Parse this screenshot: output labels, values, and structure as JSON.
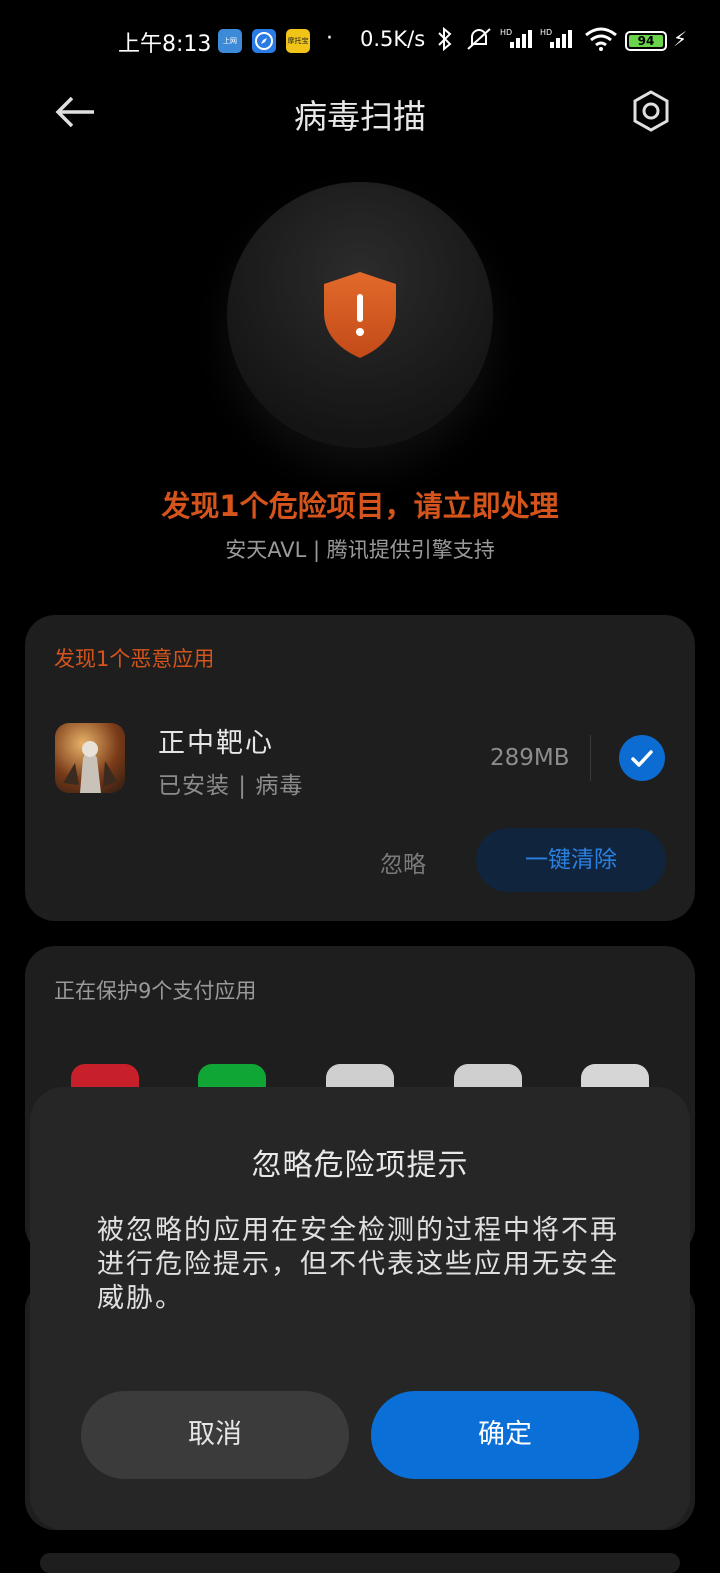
{
  "status_bar": {
    "time": "上午8:13",
    "mini_apps": [
      {
        "name": "blue-app-icon",
        "label": "上网",
        "color": "#3d8ad9"
      },
      {
        "name": "compass-app-icon",
        "label": "",
        "color": "#2a7be4"
      },
      {
        "name": "yellow-app-icon",
        "label": "摩托宝",
        "color": "#f0c419"
      }
    ],
    "dot": "·",
    "net_speed": "0.5K/s",
    "battery_level": "94",
    "battery_color": "#6ad34a"
  },
  "header": {
    "title": "病毒扫描"
  },
  "hero": {
    "title": "发现1个危险项目，请立即处理",
    "subtitle": "安天AVL | 腾讯提供引擎支持",
    "accent_color": "#d4541c"
  },
  "malware_card": {
    "label": "发现1个恶意应用",
    "app": {
      "name": "正中靶心",
      "status": "已安装 | 病毒",
      "size": "289MB",
      "selected": true
    },
    "ignore_label": "忽略",
    "clean_label": "一键清除"
  },
  "payment_card": {
    "label": "正在保护9个支付应用",
    "apps": [
      {
        "name": "red-payment-app-icon",
        "color": "#c8202a"
      },
      {
        "name": "green-payment-app-icon",
        "color": "#0fa636"
      },
      {
        "name": "bank-app-icon",
        "color": "#cfcfcf"
      },
      {
        "name": "bank-app-icon-2",
        "color": "#cfcfcf"
      },
      {
        "name": "gray-app-icon",
        "color": "#d6d6d6"
      }
    ]
  },
  "dialog": {
    "title": "忽略危险项提示",
    "body": "被忽略的应用在安全检测的过程中将不再进行危险提示，但不代表这些应用无安全威胁。",
    "cancel_label": "取消",
    "confirm_label": "确定",
    "confirm_color": "#0b6fd8"
  }
}
